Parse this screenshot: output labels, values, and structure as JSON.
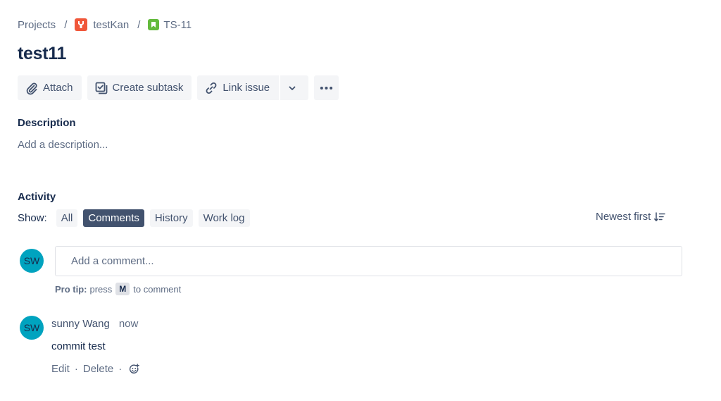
{
  "breadcrumb": {
    "projects": "Projects",
    "separator": "/",
    "project_name": "testKan",
    "issue_key": "TS-11"
  },
  "issue": {
    "title": "test11"
  },
  "toolbar": {
    "attach": "Attach",
    "create_subtask": "Create subtask",
    "link_issue": "Link issue"
  },
  "description": {
    "label": "Description",
    "placeholder": "Add a description..."
  },
  "activity": {
    "label": "Activity",
    "show_label": "Show:",
    "filters": [
      {
        "label": "All",
        "active": false
      },
      {
        "label": "Comments",
        "active": true
      },
      {
        "label": "History",
        "active": false
      },
      {
        "label": "Work log",
        "active": false
      }
    ],
    "sort_label": "Newest first"
  },
  "comment_input": {
    "avatar_initials": "SW",
    "placeholder": "Add a comment...",
    "pro_tip_label": "Pro tip:",
    "pro_tip_press": "press",
    "pro_tip_key": "M",
    "pro_tip_suffix": "to comment"
  },
  "comments": [
    {
      "avatar_initials": "SW",
      "author": "sunny Wang",
      "time": "now",
      "body": "commit test",
      "edit_label": "Edit",
      "delete_label": "Delete",
      "separator": "·"
    }
  ],
  "colors": {
    "project_icon": "#f0573a",
    "story_icon": "#63ba3c",
    "avatar": "#00a3bf",
    "active_filter": "#42526e"
  },
  "icons": {
    "project": "project-wrench-icon",
    "issue_type": "story-bookmark-icon",
    "attach": "paperclip-icon",
    "create_subtask": "subtask-icon",
    "link_issue": "link-icon",
    "dropdown": "chevron-down-icon",
    "more": "more-dots-icon",
    "sort": "sort-descending-icon",
    "reaction": "add-reaction-icon"
  }
}
